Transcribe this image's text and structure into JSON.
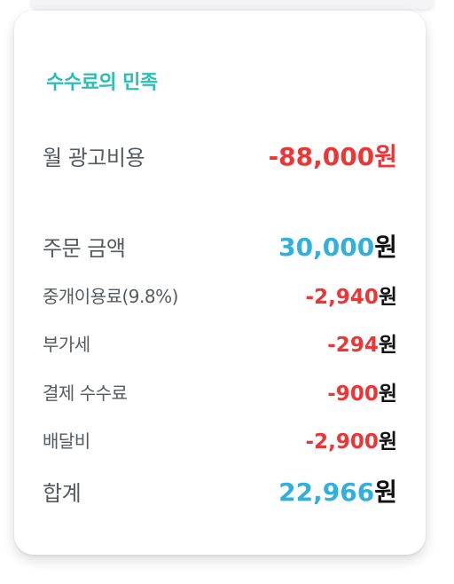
{
  "card": {
    "title": "수수료의 민족",
    "ad_cost": {
      "label": "월 광고비용",
      "amount": "-88,000",
      "unit": "원"
    },
    "rows": [
      {
        "label": "주문 금액",
        "amount": "30,000",
        "unit": "원"
      },
      {
        "label": "중개이용료(9.8%)",
        "amount": "-2,940",
        "unit": "원"
      },
      {
        "label": "부가세",
        "amount": "-294",
        "unit": "원"
      },
      {
        "label": "결제 수수료",
        "amount": "-900",
        "unit": "원"
      },
      {
        "label": "배달비",
        "amount": "-2,900",
        "unit": "원"
      }
    ],
    "total": {
      "label": "합계",
      "amount": "22,966",
      "unit": "원"
    }
  },
  "colors": {
    "title": "#2bbfb4",
    "negative": "#ee3535",
    "positive": "#31b0dc",
    "label": "#555a5f",
    "unit": "#111111"
  }
}
